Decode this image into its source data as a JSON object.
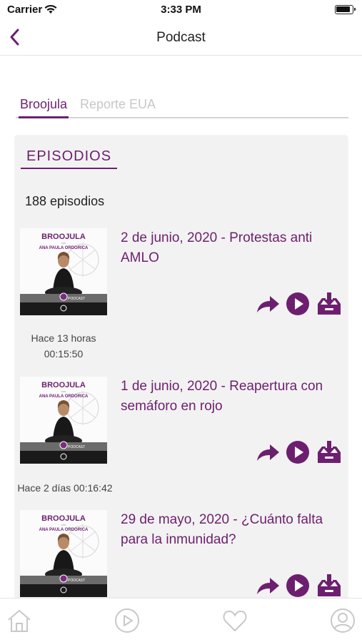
{
  "status_bar": {
    "carrier": "Carrier",
    "time": "3:33 PM"
  },
  "nav": {
    "title": "Podcast"
  },
  "tabs": [
    {
      "label": "Broojula",
      "active": true
    },
    {
      "label": "Reporte EUA",
      "active": false
    }
  ],
  "section": {
    "title": "EPISODIOS",
    "count": "188 episodios"
  },
  "cover": {
    "brand": "BROOJULA",
    "small_line": "con",
    "host": "ANA PAULA ORDORICA",
    "badge": "PODCAST"
  },
  "episodes": [
    {
      "title": "2 de junio, 2020 - Protestas anti AMLO",
      "time_ago": "Hace 13 horas",
      "duration": "00:15:50",
      "meta": ""
    },
    {
      "title": "1 de junio, 2020 - Reapertura con semáforo en rojo",
      "time_ago": "",
      "duration": "",
      "meta": "Hace 2 días 00:16:42"
    },
    {
      "title": "29 de mayo, 2020 - ¿Cuánto falta para la inmunidad?",
      "time_ago": "",
      "duration": "",
      "meta": ""
    }
  ],
  "icons": {
    "back": "chevron-left-icon",
    "share": "share-icon",
    "play": "play-icon",
    "download": "download-icon",
    "home": "home-icon",
    "player": "play-circle-icon",
    "favorites": "heart-icon",
    "profile": "user-icon"
  },
  "colors": {
    "accent": "#6d1f6f",
    "inactive_tab": "#c7c7c7",
    "card_bg": "#f2f2f2",
    "tabbar_icon": "#c8c8c8"
  }
}
